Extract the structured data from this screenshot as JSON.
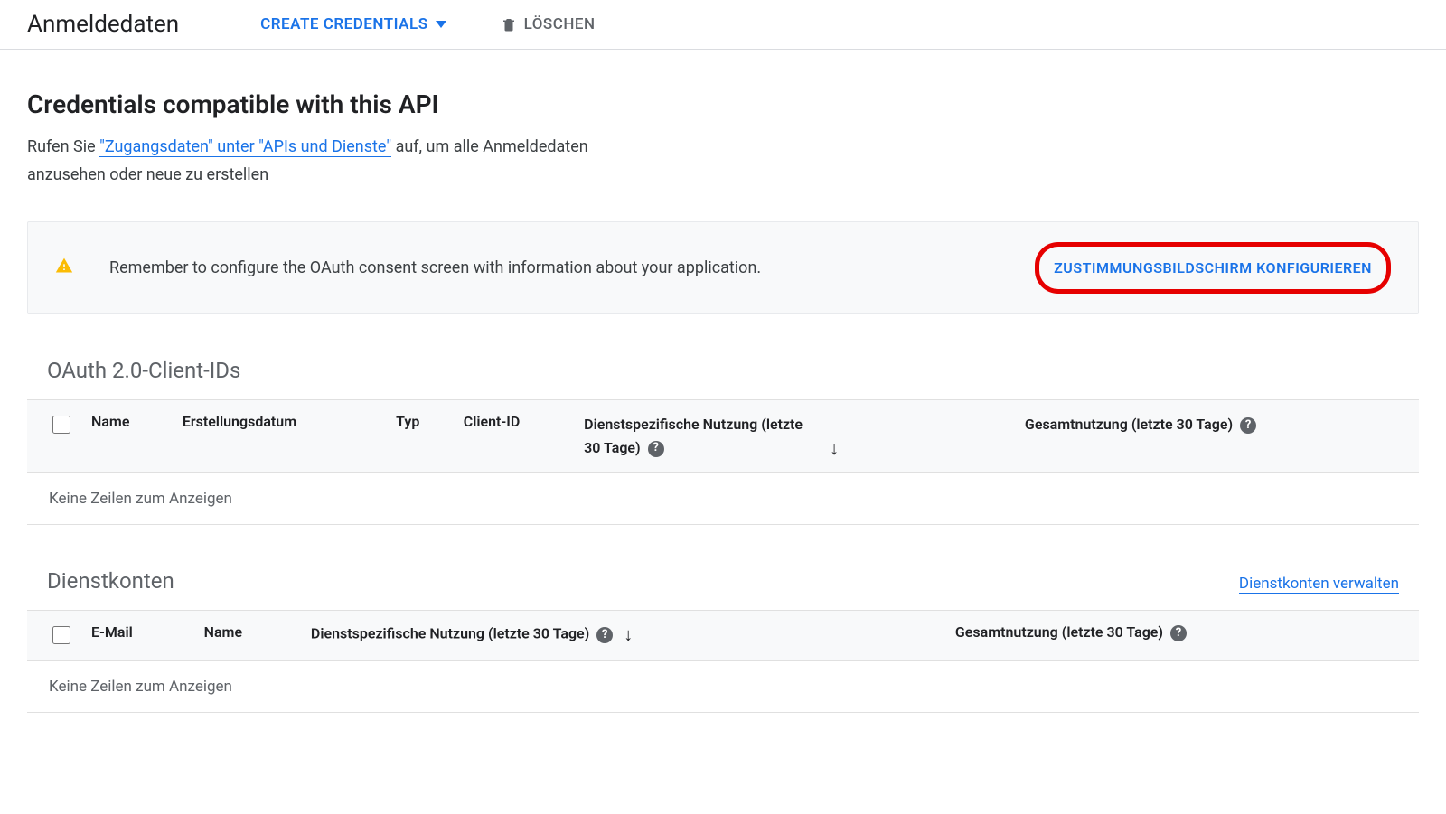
{
  "header": {
    "title": "Anmeldedaten",
    "create_label": "CREATE CREDENTIALS",
    "delete_label": "LÖSCHEN"
  },
  "main": {
    "heading": "Credentials compatible with this API",
    "intro_pre": "Rufen Sie ",
    "intro_link": "\"Zugangsdaten\" unter \"APIs und Dienste\"",
    "intro_post": " auf, um alle Anmeldedaten anzusehen oder neue zu erstellen"
  },
  "alert": {
    "text": "Remember to configure the OAuth consent screen with information about your application.",
    "button": "ZUSTIMMUNGSBILDSCHIRM KONFIGURIEREN"
  },
  "oauth": {
    "title": "OAuth 2.0-Client-IDs",
    "columns": {
      "name": "Name",
      "created": "Erstellungsdatum",
      "type": "Typ",
      "client_id": "Client-ID",
      "service_usage": "Dienstspezifische Nutzung (letzte 30 Tage)",
      "total_usage": "Gesamtnutzung (letzte 30 Tage)"
    },
    "empty": "Keine Zeilen zum Anzeigen"
  },
  "accounts": {
    "title": "Dienstkonten",
    "manage_link": "Dienstkonten verwalten",
    "columns": {
      "email": "E-Mail",
      "name": "Name",
      "service_usage": "Dienstspezifische Nutzung (letzte 30 Tage)",
      "total_usage": "Gesamtnutzung (letzte 30 Tage)"
    },
    "empty": "Keine Zeilen zum Anzeigen"
  }
}
